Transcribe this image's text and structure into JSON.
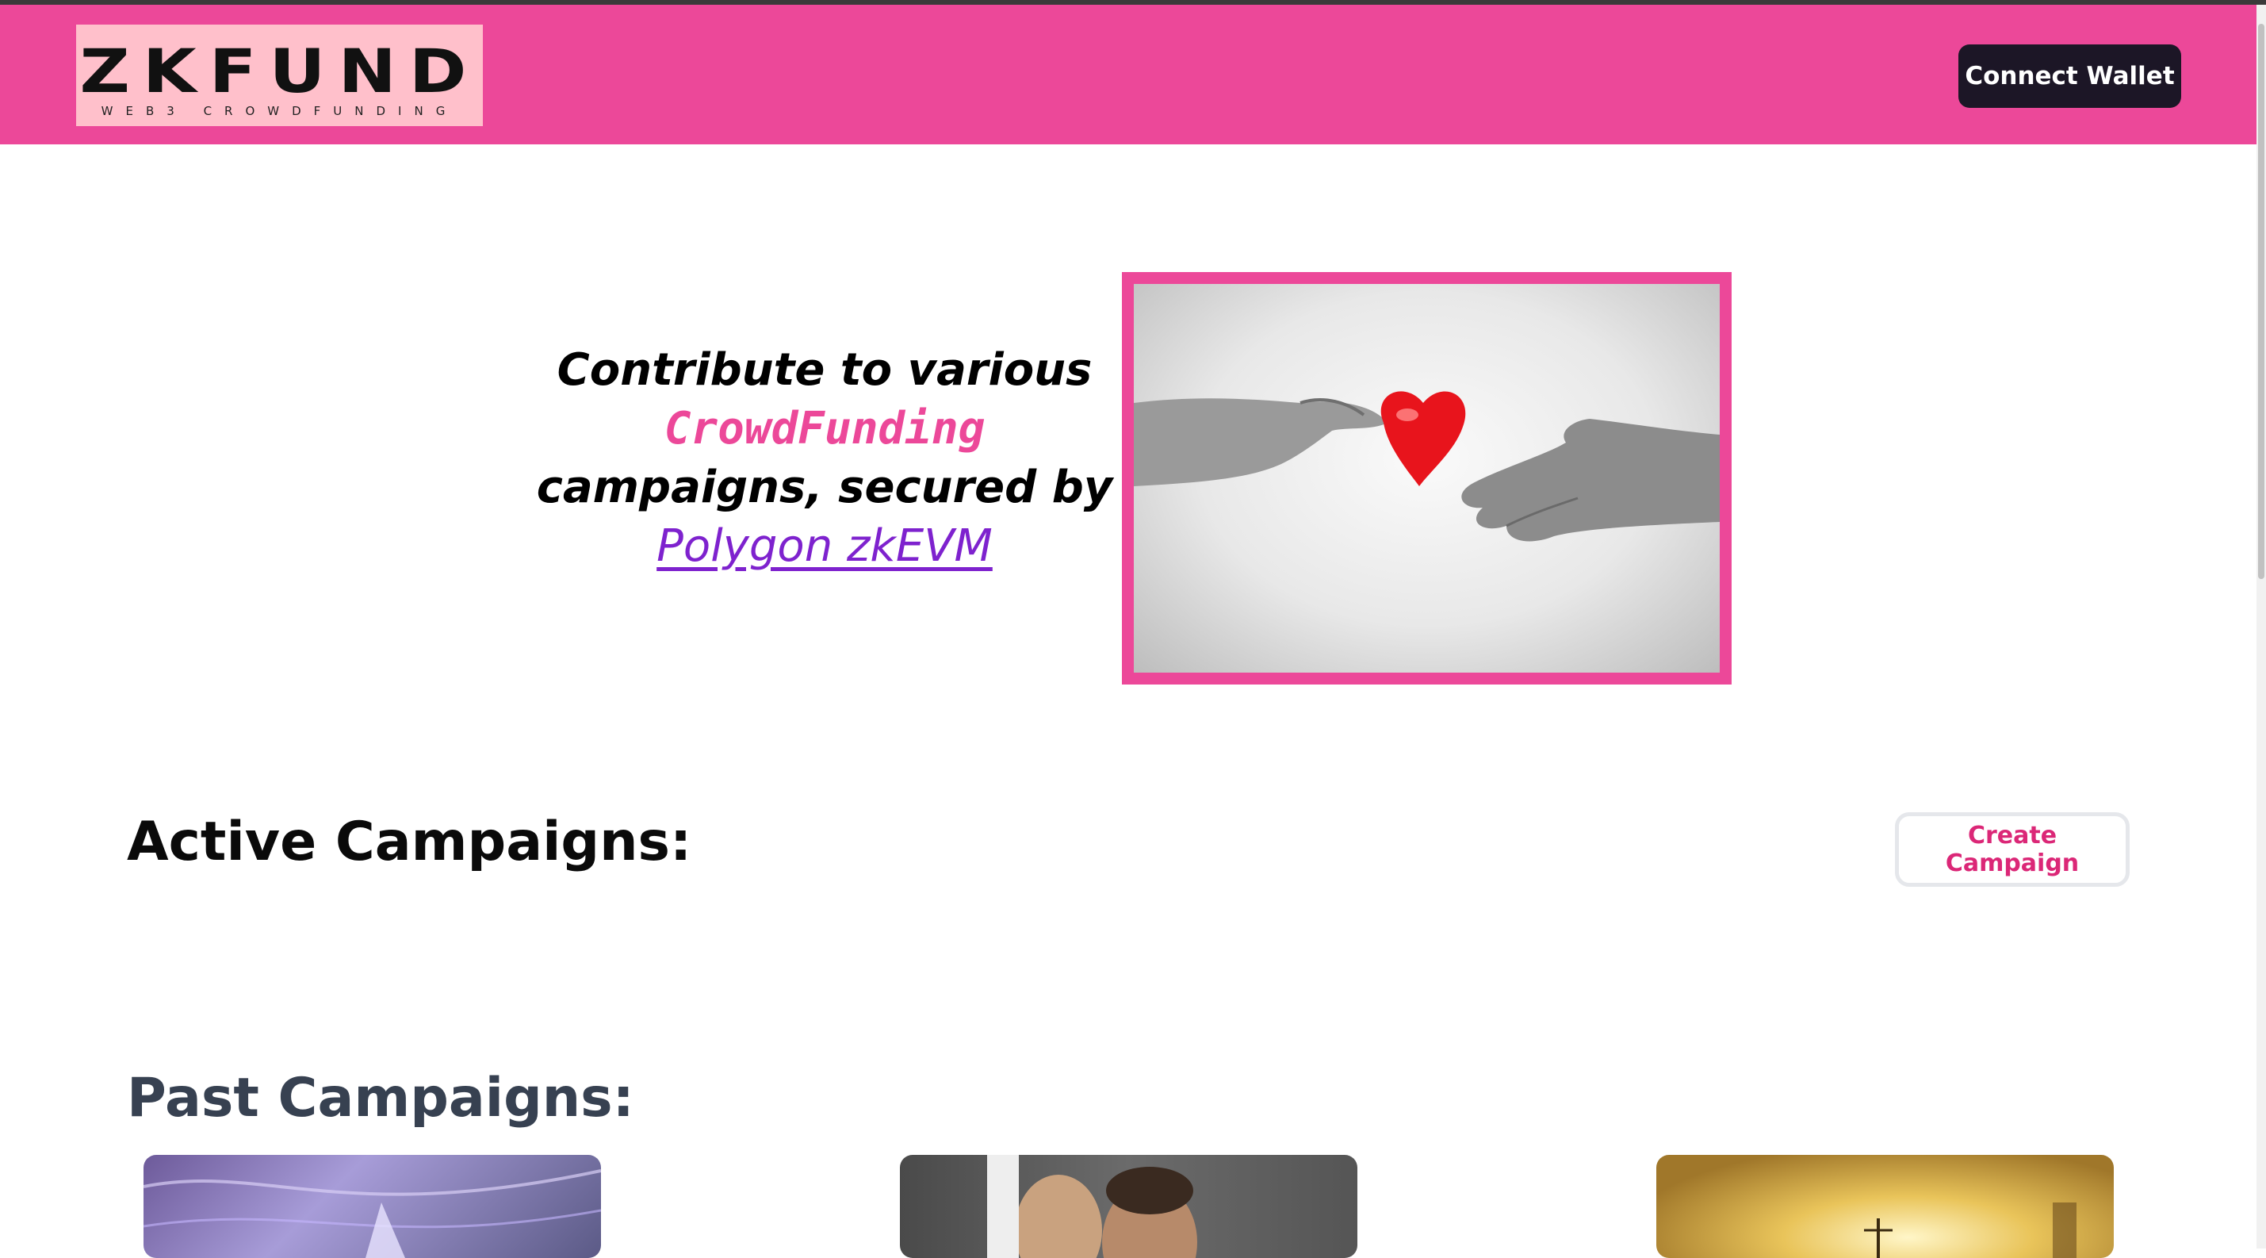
{
  "header": {
    "logo_main": "ZKFUND",
    "logo_sub": "WEB3 CROWDFUNDING",
    "connect_wallet_label": "Connect Wallet"
  },
  "hero": {
    "line1": "Contribute to various",
    "highlight": "CrowdFunding",
    "line3": "campaigns, secured by",
    "link_text": "Polygon zkEVM",
    "image_icon": "heart-handover-image"
  },
  "active": {
    "title": "Active Campaigns:",
    "create_label": "Create Campaign"
  },
  "past": {
    "title": "Past Campaigns:",
    "cards": [
      {
        "icon": "abstract-purple-image"
      },
      {
        "icon": "people-photo-image"
      },
      {
        "icon": "golden-light-image"
      }
    ]
  },
  "colors": {
    "brand_pink": "#ec4899",
    "logo_bg": "#ffc0cb",
    "wallet_btn": "#1c1626",
    "link_purple": "#7e22ce"
  }
}
